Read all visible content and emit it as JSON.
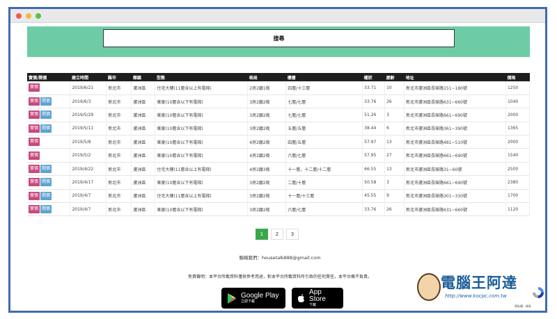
{
  "hero": {
    "search_label": "搜尋"
  },
  "table": {
    "headers": [
      "實價/開價",
      "建立時間",
      "縣市",
      "鄉鎮",
      "型態",
      "格局",
      "樓層",
      "權狀",
      "屋齡",
      "地址",
      "價格"
    ],
    "badges": {
      "sale": "實價",
      "presale": "開價"
    },
    "rows": [
      {
        "badges": [
          "實價"
        ],
        "date": "2019/6/21",
        "city": "新北市",
        "district": "蘆洲區",
        "type": "住宅大樓(11層含以上有電梯)",
        "layout": "2房2廳1衛",
        "floor": "四層/十三層",
        "area": "33.71",
        "age": "10",
        "address": "新北市蘆洲區長榮路151~180號",
        "price": "1250"
      },
      {
        "badges": [
          "實價",
          "開價"
        ],
        "date": "2019/6/3",
        "city": "新北市",
        "district": "蘆洲區",
        "type": "華廈(10層含以下有電梯)",
        "layout": "3房2廳2衛",
        "floor": "七層/七層",
        "area": "33.76",
        "age": "26",
        "address": "新北市蘆洲區長榮路631~660號",
        "price": "1040"
      },
      {
        "badges": [
          "實價",
          "開價"
        ],
        "date": "2019/5/29",
        "city": "新北市",
        "district": "蘆洲區",
        "type": "華廈(10層含以下有電梯)",
        "layout": "3房2廳2衛",
        "floor": "七層/七層",
        "area": "51.26",
        "age": "3",
        "address": "新北市蘆洲區長榮路661~690號",
        "price": "2000"
      },
      {
        "badges": [
          "實價",
          "開價"
        ],
        "date": "2019/5/11",
        "city": "新北市",
        "district": "蘆洲區",
        "type": "華廈(10層含以下有電梯)",
        "layout": "3房2廳2衛",
        "floor": "五層/五層",
        "area": "38.44",
        "age": "6",
        "address": "新北市蘆洲區長榮路361~390號",
        "price": "1365"
      },
      {
        "badges": [
          "實價"
        ],
        "date": "2019/5/8",
        "city": "新北市",
        "district": "蘆洲區",
        "type": "華廈(10層含以下有電梯)",
        "layout": "4房2廳2衛",
        "floor": "四層/五層",
        "area": "57.97",
        "age": "13",
        "address": "新北市蘆洲區長榮路481~510號",
        "price": "2000"
      },
      {
        "badges": [
          "實價"
        ],
        "date": "2019/5/2",
        "city": "新北市",
        "district": "蘆洲區",
        "type": "華廈(10層含以下有電梯)",
        "layout": "4房2廳2衛",
        "floor": "六層/七層",
        "area": "57.95",
        "age": "27",
        "address": "新北市蘆洲區長榮路661~690號",
        "price": "1540"
      },
      {
        "badges": [
          "實價",
          "開價"
        ],
        "date": "2019/4/22",
        "city": "新北市",
        "district": "蘆洲區",
        "type": "住宅大樓(11層含以上有電梯)",
        "layout": "4房2廳3衛",
        "floor": "十一層，十二層/十二層",
        "area": "66.55",
        "age": "13",
        "address": "新北市蘆洲區長榮路31~60號",
        "price": "2500"
      },
      {
        "badges": [
          "實價",
          "開價"
        ],
        "date": "2019/4/17",
        "city": "新北市",
        "district": "蘆洲區",
        "type": "華廈(10層含以下有電梯)",
        "layout": "3房2廳2衛",
        "floor": "二層/十層",
        "area": "50.58",
        "age": "3",
        "address": "新北市蘆洲區長榮路661~690號",
        "price": "2380"
      },
      {
        "badges": [
          "實價",
          "開價"
        ],
        "date": "2019/4/7",
        "city": "新北市",
        "district": "蘆洲區",
        "type": "住宅大樓(11層含以上有電梯)",
        "layout": "3房2廳2衛",
        "floor": "十一層/十三層",
        "area": "45.55",
        "age": "9",
        "address": "新北市蘆洲區長榮路301~330號",
        "price": "1700"
      },
      {
        "badges": [
          "實價",
          "開價"
        ],
        "date": "2019/4/7",
        "city": "新北市",
        "district": "蘆洲區",
        "type": "華廈(10層含以下有電梯)",
        "layout": "3房2廳2衛",
        "floor": "六層/七層",
        "area": "33.76",
        "age": "26",
        "address": "新北市蘆洲區長榮路631~660號",
        "price": "1120"
      }
    ]
  },
  "pager": {
    "pages": [
      "1",
      "2",
      "3"
    ],
    "active": "1"
  },
  "footer": {
    "contact": "聯絡我們：housetalk888@gmail.com",
    "disclaimer": "免責聲明：本平台所載資料僅供參考用途，對本平台所載資料所引致的任何責任，本平台概不負責。",
    "google_play": {
      "title": "Google Play",
      "sub": "立即下載"
    },
    "app_store": {
      "title": "App Store",
      "sub": "下載"
    }
  },
  "watermark": {
    "title": "電腦王阿達",
    "url": "http://www.kocpc.com.tw"
  },
  "recaptcha": {
    "text": "隱私權・條款"
  },
  "colors": {
    "hero": "#6dcca6",
    "sale_badge": "#c9487d",
    "presale_badge": "#5ea3d0",
    "page_active": "#3aa84a",
    "frame": "#3f6bb0"
  }
}
